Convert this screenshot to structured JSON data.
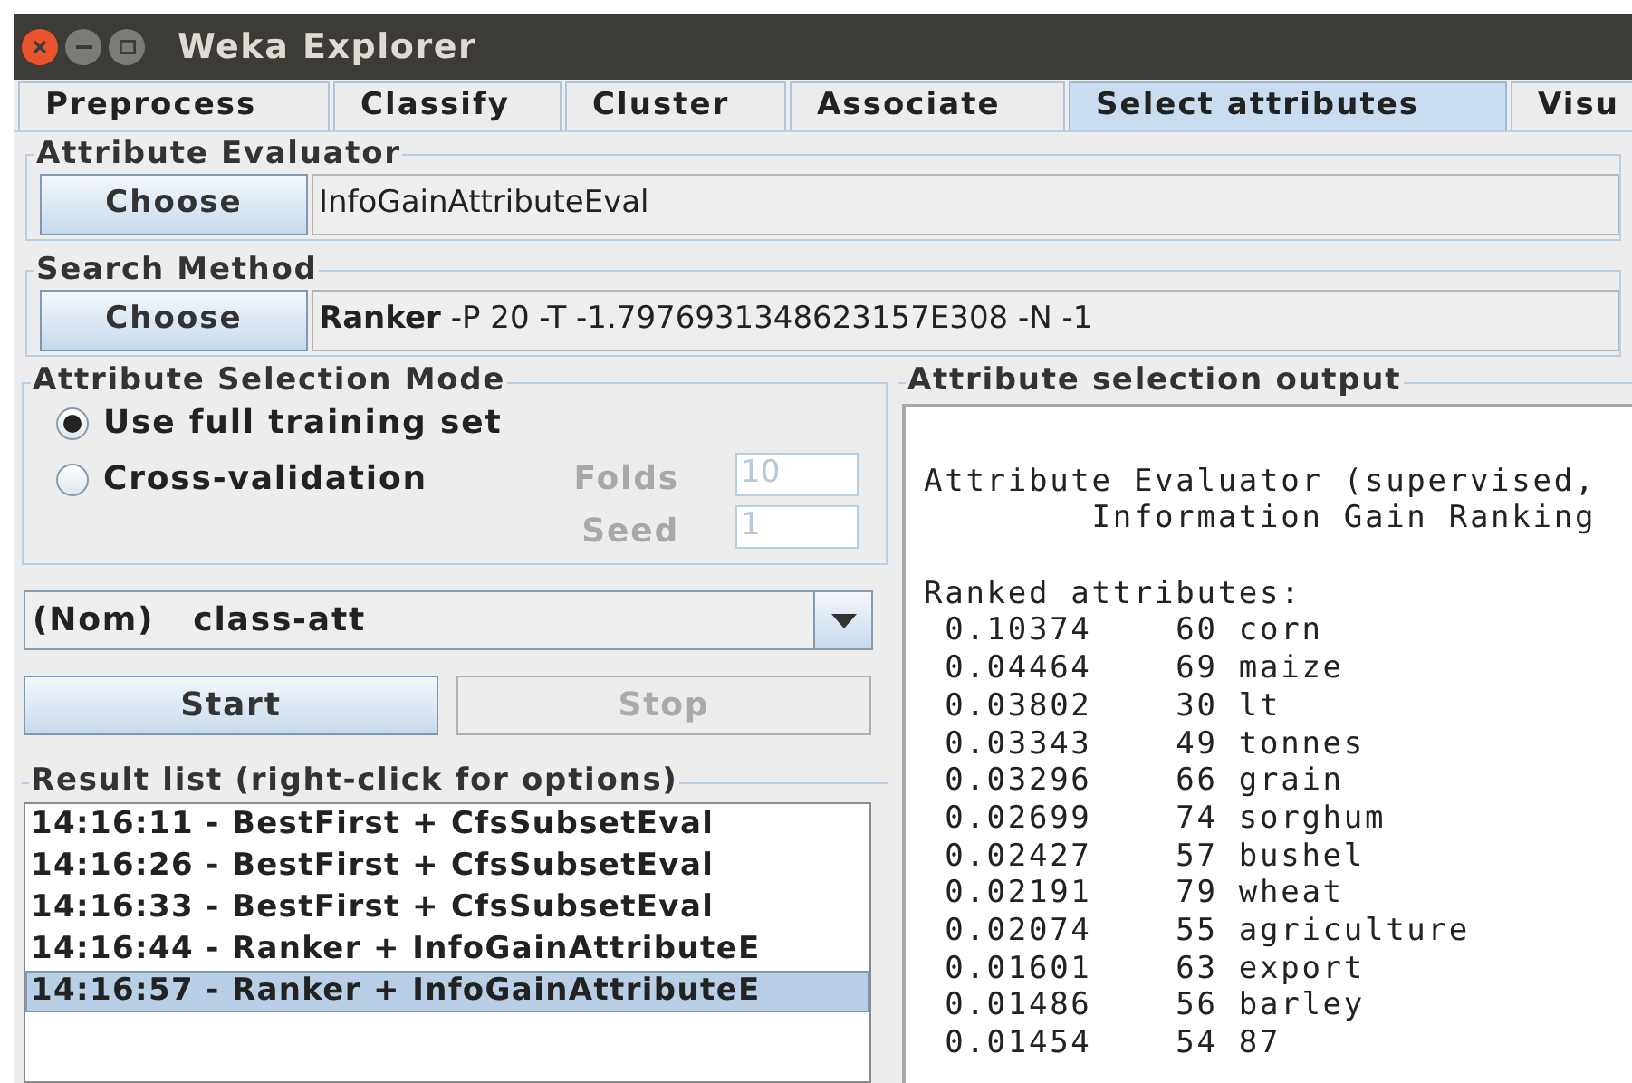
{
  "window": {
    "title": "Weka Explorer"
  },
  "tabs": [
    {
      "label": "Preprocess",
      "selected": false
    },
    {
      "label": "Classify",
      "selected": false
    },
    {
      "label": "Cluster",
      "selected": false
    },
    {
      "label": "Associate",
      "selected": false
    },
    {
      "label": "Select attributes",
      "selected": true
    },
    {
      "label": "Visu",
      "selected": false
    }
  ],
  "attribute_evaluator": {
    "title": "Attribute Evaluator",
    "button": "Choose",
    "value": "InfoGainAttributeEval"
  },
  "search_method": {
    "title": "Search Method",
    "button": "Choose",
    "value": "**Ranker** -P 20 -T -1.7976931348623157E308 -N -1"
  },
  "selection_mode": {
    "title": "Attribute Selection Mode",
    "options": [
      {
        "label": "Use full training set",
        "selected": true
      },
      {
        "label": "Cross-validation",
        "selected": false
      }
    ],
    "fields": [
      {
        "label": "Folds",
        "value": "10",
        "disabled": true
      },
      {
        "label": "Seed",
        "value": "1",
        "disabled": true
      }
    ]
  },
  "class_dropdown": {
    "value": "(Nom)   class-att"
  },
  "buttons": [
    {
      "label": "Start",
      "disabled": false
    },
    {
      "label": "Stop",
      "disabled": true
    }
  ],
  "result_list": {
    "title": "Result list (right-click for options)",
    "items": [
      {
        "label": "14:16:11 - BestFirst + CfsSubsetEval",
        "selected": false
      },
      {
        "label": "14:16:26 - BestFirst + CfsSubsetEval",
        "selected": false
      },
      {
        "label": "14:16:33 - BestFirst + CfsSubsetEval",
        "selected": false
      },
      {
        "label": "14:16:44 - Ranker + InfoGainAttributeE",
        "selected": false
      },
      {
        "label": "14:16:57 - Ranker + InfoGainAttributeE",
        "selected": true
      }
    ]
  },
  "output": {
    "title": "Attribute selection output",
    "paragraphs": [
      [
        "Attribute Evaluator (supervised,",
        "        Information Gain Ranking"
      ],
      [
        "Ranked attributes:",
        " 0.10374    60 corn",
        " 0.04464    69 maize",
        " 0.03802    30 lt",
        " 0.03343    49 tonnes",
        " 0.03296    66 grain",
        " 0.02699    74 sorghum",
        " 0.02427    57 bushel",
        " 0.02191    79 wheat",
        " 0.02074    55 agriculture",
        " 0.01601    63 export",
        " 0.01486    56 barley",
        " 0.01454    54 87"
      ]
    ]
  }
}
